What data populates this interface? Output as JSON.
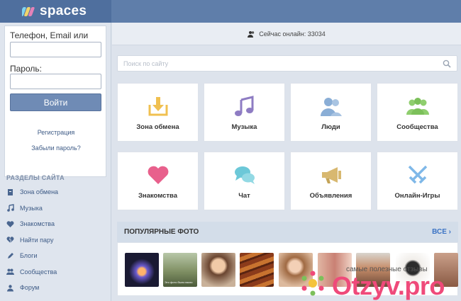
{
  "header": {
    "logo_text": "spaces"
  },
  "login": {
    "login_label": "Телефон, Email или ник:",
    "password_label": "Пароль:",
    "submit_label": "Войти",
    "register_link": "Регистрация",
    "forgot_link": "Забыли пароль?"
  },
  "sidebar": {
    "section_title": "РАЗДЕЛЫ САЙТА",
    "items": [
      {
        "label": "Зона обмена",
        "icon": "file-icon"
      },
      {
        "label": "Музыка",
        "icon": "music-icon"
      },
      {
        "label": "Знакомства",
        "icon": "heart-icon"
      },
      {
        "label": "Найти пару",
        "icon": "broken-heart-icon"
      },
      {
        "label": "Блоги",
        "icon": "pen-icon"
      },
      {
        "label": "Сообщества",
        "icon": "group-icon"
      },
      {
        "label": "Форум",
        "icon": "forum-icon"
      }
    ]
  },
  "online": {
    "text": "Сейчас онлайн: 33034"
  },
  "search": {
    "placeholder": "Поиск по сайту"
  },
  "tiles": [
    {
      "label": "Зона обмена",
      "icon": "download-icon",
      "color": "#f0c050"
    },
    {
      "label": "Музыка",
      "icon": "music-note-icon",
      "color": "#8e7cc3"
    },
    {
      "label": "Люди",
      "icon": "people-icon",
      "color": "#8aaed6"
    },
    {
      "label": "Сообщества",
      "icon": "community-icon",
      "color": "#8fce6e"
    },
    {
      "label": "Знакомства",
      "icon": "heart-icon",
      "color": "#e8608c"
    },
    {
      "label": "Чат",
      "icon": "chat-icon",
      "color": "#6cc8d8"
    },
    {
      "label": "Объявления",
      "icon": "megaphone-icon",
      "color": "#d8b870"
    },
    {
      "label": "Онлайн-Игры",
      "icon": "swords-icon",
      "color": "#7fb8e8"
    }
  ],
  "popular": {
    "title": "ПОПУЛЯРНЫЕ ФОТО",
    "all_label": "ВСЕ",
    "photo_caption": "Это фото было взято"
  },
  "watermark": {
    "tagline": "самые полезные отзывы",
    "brand": "Otzyv.pro"
  }
}
